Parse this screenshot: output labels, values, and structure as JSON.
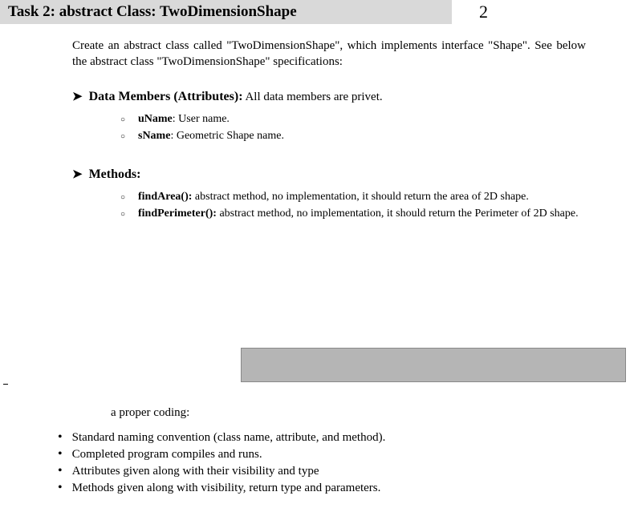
{
  "header": {
    "title": "Task 2: abstract Class: TwoDimensionShape",
    "page_number": "2"
  },
  "intro": "Create an abstract class called \"TwoDimensionShape\", which implements interface \"Shape\". See below the abstract class \"TwoDimensionShape\" specifications:",
  "data_members": {
    "arrow": "➤",
    "heading": "Data Members (Attributes):",
    "subheading": " All data members are privet.",
    "items": [
      {
        "bullet": "○",
        "name": "uName",
        "desc": ": User name."
      },
      {
        "bullet": "○",
        "name": "sName",
        "desc": ": Geometric Shape name."
      }
    ]
  },
  "methods": {
    "arrow": "➤",
    "heading": "Methods:",
    "items": [
      {
        "bullet": "○",
        "name": "findArea():",
        "desc": "  abstract method, no implementation, it should return the area of 2D shape."
      },
      {
        "bullet": "○",
        "name": "findPerimeter():",
        "desc": " abstract method, no implementation, it should return the Perimeter of 2D shape."
      }
    ]
  },
  "footer": {
    "proper_coding_label": "a proper coding:",
    "points": [
      {
        "bullet": "•",
        "text": "Standard naming convention (class name, attribute, and method)."
      },
      {
        "bullet": "•",
        "text": "Completed program compiles and runs."
      },
      {
        "bullet": "•",
        "text": "Attributes given along with their visibility and type"
      },
      {
        "bullet": "•",
        "text": "Methods given along with visibility, return type and parameters."
      }
    ]
  }
}
